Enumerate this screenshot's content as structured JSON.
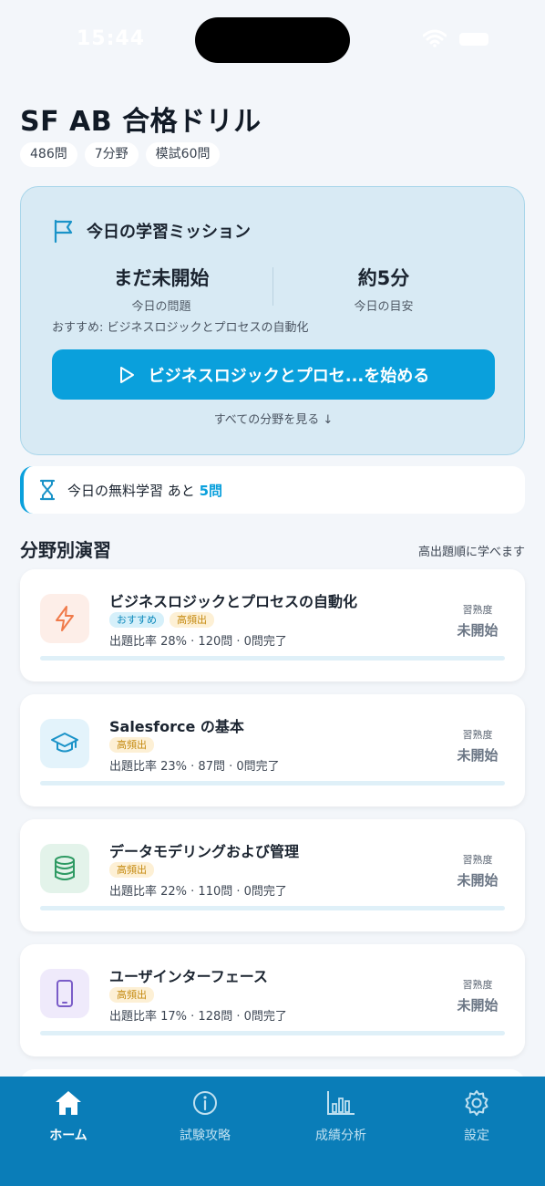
{
  "status_bar": {
    "time": "15:44"
  },
  "header": {
    "title": "SF AB 合格ドリル",
    "chips": [
      "486問",
      "7分野",
      "模試60問"
    ]
  },
  "mission": {
    "title": "今日の学習ミッション",
    "stat_left": {
      "value": "まだ未開始",
      "label": "今日の問題"
    },
    "stat_right": {
      "value": "約5分",
      "label": "今日の目安"
    },
    "recommend": "おすすめ: ビジネスロジックとプロセスの自動化",
    "start_button": "ビジネスロジックとプロセ...を始める",
    "see_all": "すべての分野を見る ↓"
  },
  "free_study": {
    "label": "今日の無料学習 あと",
    "count": "5問"
  },
  "section": {
    "title": "分野別演習",
    "note": "高出題順に学べます"
  },
  "cards": [
    {
      "title": "ビジネスロジックとプロセスの自動化",
      "tags": [
        "おすすめ",
        "高頻出"
      ],
      "meta": "出題比率 28% · 120問 · 0問完了",
      "mastery_label": "習熟度",
      "mastery_value": "未開始",
      "progress": 0,
      "icon": "lightning-icon",
      "icon_bg": "#fdeee8",
      "icon_color": "#f07a4a"
    },
    {
      "title": "Salesforce の基本",
      "tags": [
        "高頻出"
      ],
      "meta": "出題比率 23% · 87問 · 0問完了",
      "mastery_label": "習熟度",
      "mastery_value": "未開始",
      "progress": 0,
      "icon": "graduation-cap-icon",
      "icon_bg": "#e3f3fb",
      "icon_color": "#1a93c8"
    },
    {
      "title": "データモデリングおよび管理",
      "tags": [
        "高頻出"
      ],
      "meta": "出題比率 22% · 110問 · 0問完了",
      "mastery_label": "習熟度",
      "mastery_value": "未開始",
      "progress": 0,
      "icon": "database-icon",
      "icon_bg": "#e3f3ea",
      "icon_color": "#2e9a63"
    },
    {
      "title": "ユーザインターフェース",
      "tags": [
        "高頻出"
      ],
      "meta": "出題比率 17% · 128問 · 0問完了",
      "mastery_label": "習熟度",
      "mastery_value": "未開始",
      "progress": 0,
      "icon": "smartphone-icon",
      "icon_bg": "#efeafb",
      "icon_color": "#7a5cc8"
    }
  ],
  "tabbar": {
    "active": "home",
    "tabs": [
      {
        "id": "home",
        "label": "ホーム",
        "icon": "home-icon"
      },
      {
        "id": "strategy",
        "label": "試験攻略",
        "icon": "info-icon"
      },
      {
        "id": "analysis",
        "label": "成績分析",
        "icon": "bar-chart-icon"
      },
      {
        "id": "settings",
        "label": "設定",
        "icon": "gear-icon"
      }
    ]
  },
  "colors": {
    "accent": "#0aa0dc",
    "tabbar": "#0a7db8",
    "mission_bg": "#d8eaf4"
  }
}
